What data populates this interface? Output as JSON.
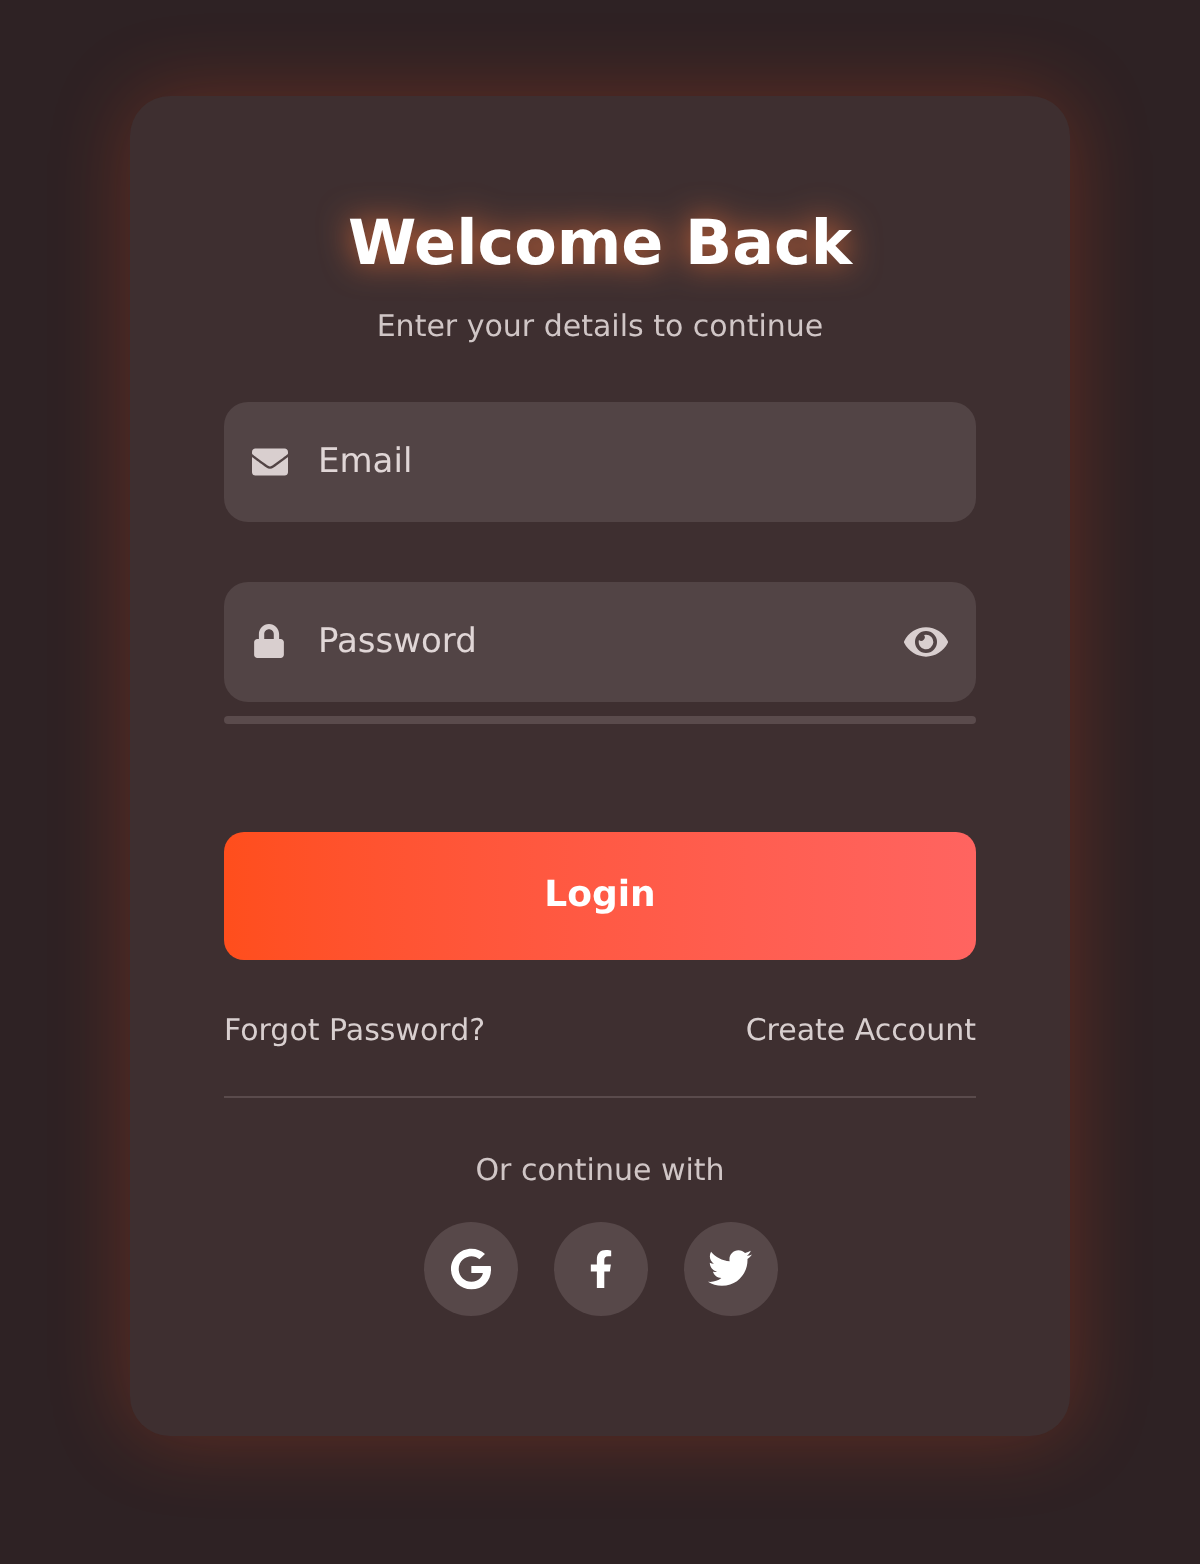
{
  "title": "Welcome Back",
  "subtitle": "Enter your details to continue",
  "fields": [
    {
      "kind": "email",
      "placeholder": "Email"
    },
    {
      "kind": "password",
      "placeholder": "Password"
    }
  ],
  "login_button": "Login",
  "links": [
    "Forgot Password?",
    "Create Account"
  ],
  "divider_text": "Or continue with",
  "socials": [
    {
      "kind": "google"
    },
    {
      "kind": "facebook"
    },
    {
      "kind": "twitter"
    }
  ]
}
